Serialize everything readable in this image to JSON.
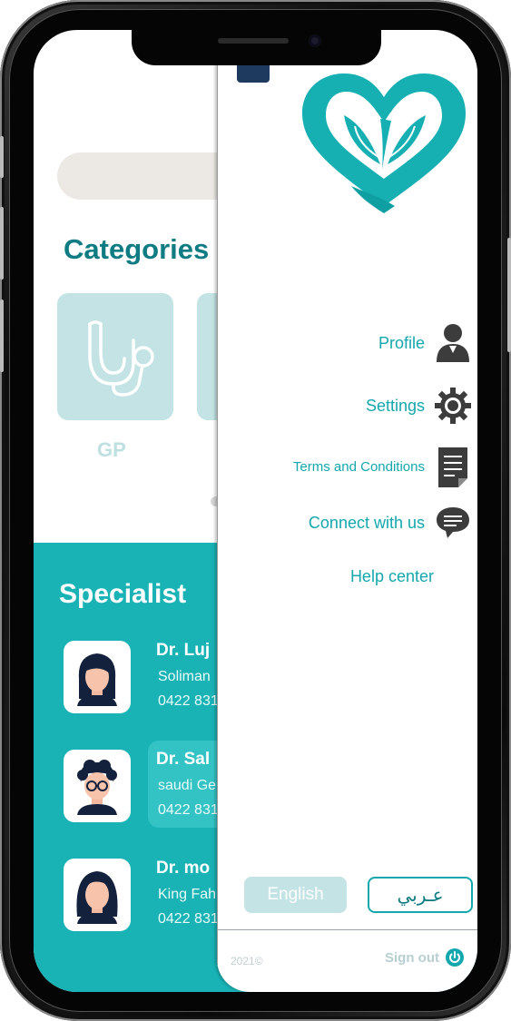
{
  "home": {
    "categories_title": "Categories",
    "categories": [
      {
        "label": "GP",
        "icon": "stethoscope-icon"
      },
      {
        "label": "",
        "icon": ""
      }
    ],
    "specialist_title": "Specialist",
    "doctors": [
      {
        "name": "Dr. Luj",
        "place": "Soliman",
        "phone": "0422 831",
        "avatar": "doctor-woman-short-hair-avatar"
      },
      {
        "name": "Dr. Sal",
        "place": "saudi Ge",
        "phone": "0422 831",
        "avatar": "doctor-man-glasses-avatar"
      },
      {
        "name": "Dr. mo",
        "place": "King Fah",
        "phone": "0422 831",
        "avatar": "doctor-woman-long-hair-avatar"
      }
    ]
  },
  "drawer": {
    "menu": [
      {
        "label": "Profile",
        "icon": "user-icon"
      },
      {
        "label": "Settings",
        "icon": "gear-icon"
      },
      {
        "label": "Terms and Conditions",
        "icon": "document-icon"
      },
      {
        "label": "Connect with us",
        "icon": "chat-bubble-icon"
      },
      {
        "label": "Help center",
        "icon": ""
      }
    ],
    "language": {
      "english": "English",
      "arabic": "عـربي"
    },
    "footer": {
      "year": "2021©",
      "signout": "Sign out"
    }
  },
  "colors": {
    "teal": "#19b3b5",
    "teal_dark": "#0e7c82",
    "accent": "#14a7ad",
    "card": "#c4e3e4"
  }
}
